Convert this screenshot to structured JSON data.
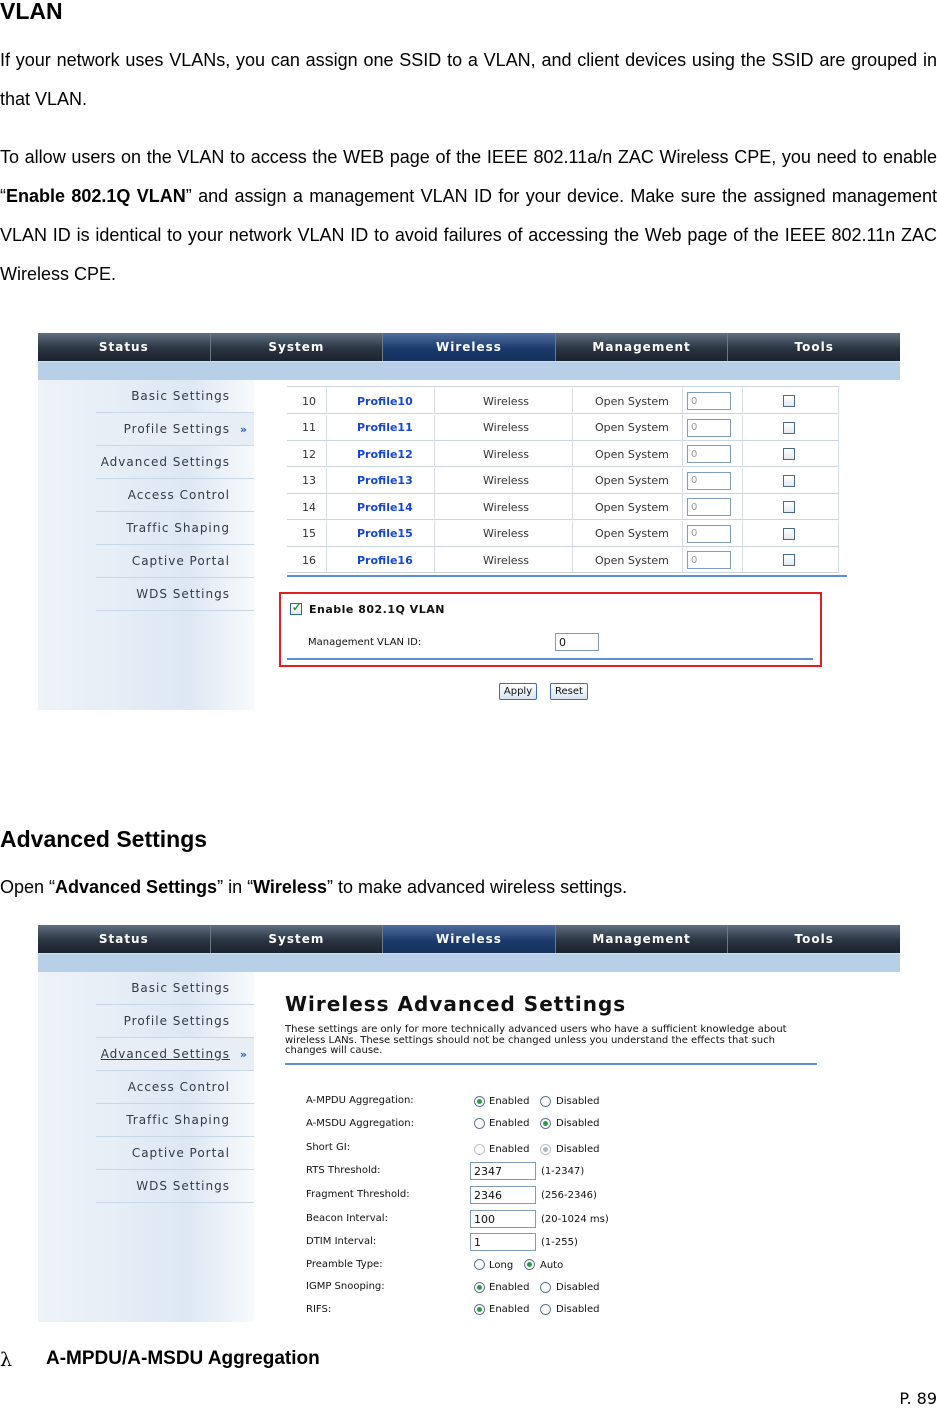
{
  "vlan": {
    "heading": "VLAN",
    "para1": "If your network uses VLANs, you can assign one SSID to a VLAN, and client devices using the SSID are grouped in that VLAN.",
    "para2_pre": "To allow users on the VLAN to access the WEB page of the IEEE 802.11a/n ZAC Wireless CPE, you need to enable “",
    "para2_bold": "Enable 802.1Q VLAN",
    "para2_post": "” and assign a management VLAN ID for your device.    Make sure the assigned management VLAN ID is identical to your network VLAN ID to avoid failures of accessing the Web page of the IEEE 802.11n ZAC Wireless CPE."
  },
  "nav": {
    "tabs": [
      "Status",
      "System",
      "Wireless",
      "Management",
      "Tools"
    ],
    "active": "Wireless"
  },
  "sidebar": {
    "items": [
      "Basic Settings",
      "Profile Settings",
      "Advanced Settings",
      "Access Control",
      "Traffic Shaping",
      "Captive Portal",
      "WDS Settings"
    ]
  },
  "profiles": {
    "rows": [
      {
        "num": "10",
        "name": "Profile10",
        "type": "Wireless",
        "auth": "Open System",
        "vlan": "0"
      },
      {
        "num": "11",
        "name": "Profile11",
        "type": "Wireless",
        "auth": "Open System",
        "vlan": "0"
      },
      {
        "num": "12",
        "name": "Profile12",
        "type": "Wireless",
        "auth": "Open System",
        "vlan": "0"
      },
      {
        "num": "13",
        "name": "Profile13",
        "type": "Wireless",
        "auth": "Open System",
        "vlan": "0"
      },
      {
        "num": "14",
        "name": "Profile14",
        "type": "Wireless",
        "auth": "Open System",
        "vlan": "0"
      },
      {
        "num": "15",
        "name": "Profile15",
        "type": "Wireless",
        "auth": "Open System",
        "vlan": "0"
      },
      {
        "num": "16",
        "name": "Profile16",
        "type": "Wireless",
        "auth": "Open System",
        "vlan": "0"
      }
    ],
    "enable_label": "Enable  802.1Q VLAN",
    "mgmt_label": "Management VLAN ID:",
    "mgmt_value": "0",
    "apply": "Apply",
    "reset": "Reset"
  },
  "advanced": {
    "heading": "Advanced Settings",
    "intro_pre": "Open “",
    "intro_b1": "Advanced Settings",
    "intro_mid": "” in “",
    "intro_b2": "Wireless",
    "intro_post": "” to make advanced wireless settings.",
    "panel_title": "Wireless Advanced Settings",
    "panel_desc": "These settings are only for more technically advanced users who have a sufficient knowledge about wireless LANs. These settings should not be changed unless you understand the effects that such changes will cause.",
    "fields": {
      "ampdu": {
        "label": "A-MPDU Aggregation:",
        "opt1": "Enabled",
        "opt2": "Disabled"
      },
      "amsdu": {
        "label": "A-MSDU Aggregation:",
        "opt1": "Enabled",
        "opt2": "Disabled"
      },
      "shortgi": {
        "label": "Short GI:",
        "opt1": "Enabled",
        "opt2": "Disabled"
      },
      "rts": {
        "label": "RTS Threshold:",
        "value": "2347",
        "hint": "(1-2347)"
      },
      "frag": {
        "label": "Fragment Threshold:",
        "value": "2346",
        "hint": "(256-2346)"
      },
      "beacon": {
        "label": "Beacon Interval:",
        "value": "100",
        "hint": "(20-1024 ms)"
      },
      "dtim": {
        "label": "DTIM Interval:",
        "value": "1",
        "hint": "(1-255)"
      },
      "preamble": {
        "label": "Preamble Type:",
        "opt1": "Long",
        "opt2": "Auto"
      },
      "igmp": {
        "label": "IGMP Snooping:",
        "opt1": "Enabled",
        "opt2": "Disabled"
      },
      "rifs": {
        "label": "RIFS:",
        "opt1": "Enabled",
        "opt2": "Disabled"
      }
    }
  },
  "bullet": {
    "symbol": "λ",
    "text": "A-MPDU/A-MSDU Aggregation"
  },
  "page_number": "P. 89"
}
